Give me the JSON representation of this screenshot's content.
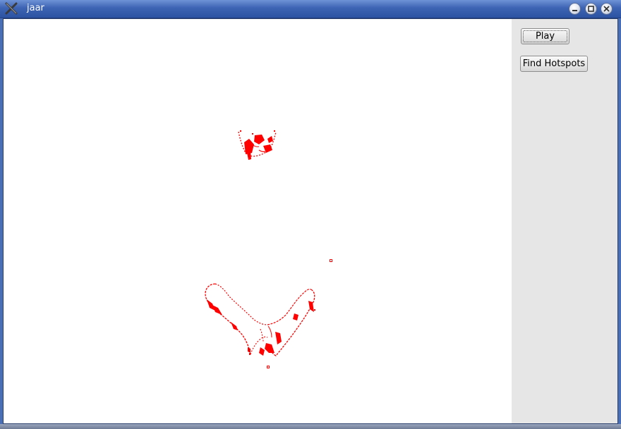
{
  "window": {
    "title": "jaar"
  },
  "sidebar": {
    "play_label": "Play",
    "hotspots_label": "Find Hotspots"
  },
  "colors": {
    "trace": "#ff0000",
    "titlebar": "#3d63b3",
    "panel": "#e6e6e6"
  },
  "icons": {
    "app": "x-app-icon",
    "minimize": "minimize-icon",
    "maximize": "maximize-icon",
    "close": "close-icon"
  }
}
